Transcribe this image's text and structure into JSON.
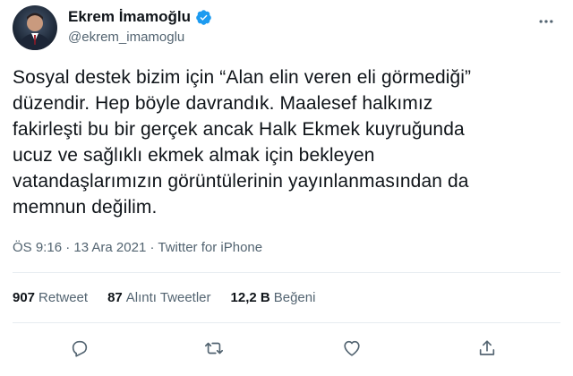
{
  "author": {
    "display_name": "Ekrem İmamoğlu",
    "handle": "@ekrem_imamoglu",
    "verified": true
  },
  "tweet": {
    "text": "Sosyal destek bizim için “Alan elin veren eli görmediği”\ndüzendir. Hep böyle davrandık. Maalesef halkımız\nfakirleşti bu bir gerçek ancak Halk Ekmek kuyruğunda\nucuz ve sağlıklı ekmek almak için bekleyen\nvatandaşlarımızın görüntülerinin yayınlanmasından da\nmemnun değilim.",
    "time": "ÖS 9:16",
    "separator": "·",
    "date": "13 Ara 2021",
    "source": "Twitter for iPhone"
  },
  "stats": {
    "retweets_count": "907",
    "retweets_label": "Retweet",
    "quotes_count": "87",
    "quotes_label": "Alıntı Tweetler",
    "likes_count": "12,2 B",
    "likes_label": "Beğeni"
  },
  "icons": {
    "more": "more-dots-icon",
    "reply": "reply-icon",
    "retweet": "retweet-icon",
    "like": "heart-icon",
    "share": "share-icon",
    "verified": "verified-badge-icon"
  },
  "colors": {
    "text": "#0f1419",
    "secondary": "#536471",
    "verified": "#1d9bf0",
    "divider": "#e6ecf0"
  }
}
